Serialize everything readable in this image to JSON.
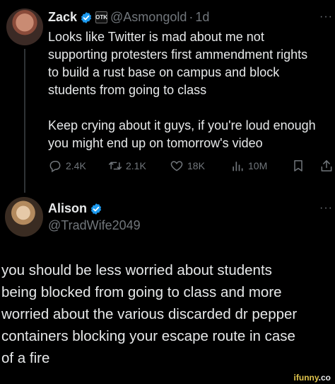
{
  "tweet": {
    "author_name": "Zack",
    "handle": "@Asmongold",
    "separator": "·",
    "time": "1d",
    "affiliate_badge_text": "OTK",
    "more_label": "···",
    "text_lines": [
      "Looks like Twitter is mad about me not",
      "supporting protesters first ammendment rights",
      "to build a rust base on campus and block",
      "students from going to class",
      "",
      "Keep crying about it guys, if you're loud enough",
      "you might end up on tomorrow's video"
    ],
    "actions": {
      "replies": "2.4K",
      "reposts": "2.1K",
      "likes": "18K",
      "views": "10M"
    }
  },
  "reply": {
    "author_name": "Alison",
    "handle": "@TradWife2049",
    "more_label": "···",
    "text_lines": [
      "you should be less worried about students",
      "being blocked from going to class and more",
      "worried about the various discarded dr pepper",
      "containers blocking your escape route in case",
      "of a fire"
    ]
  },
  "watermark": {
    "brand": "ifunny",
    "suffix": ".co"
  },
  "colors": {
    "background": "#000000",
    "text": "#e7e9ea",
    "muted": "#71767b",
    "verified": "#1d9bf0"
  }
}
